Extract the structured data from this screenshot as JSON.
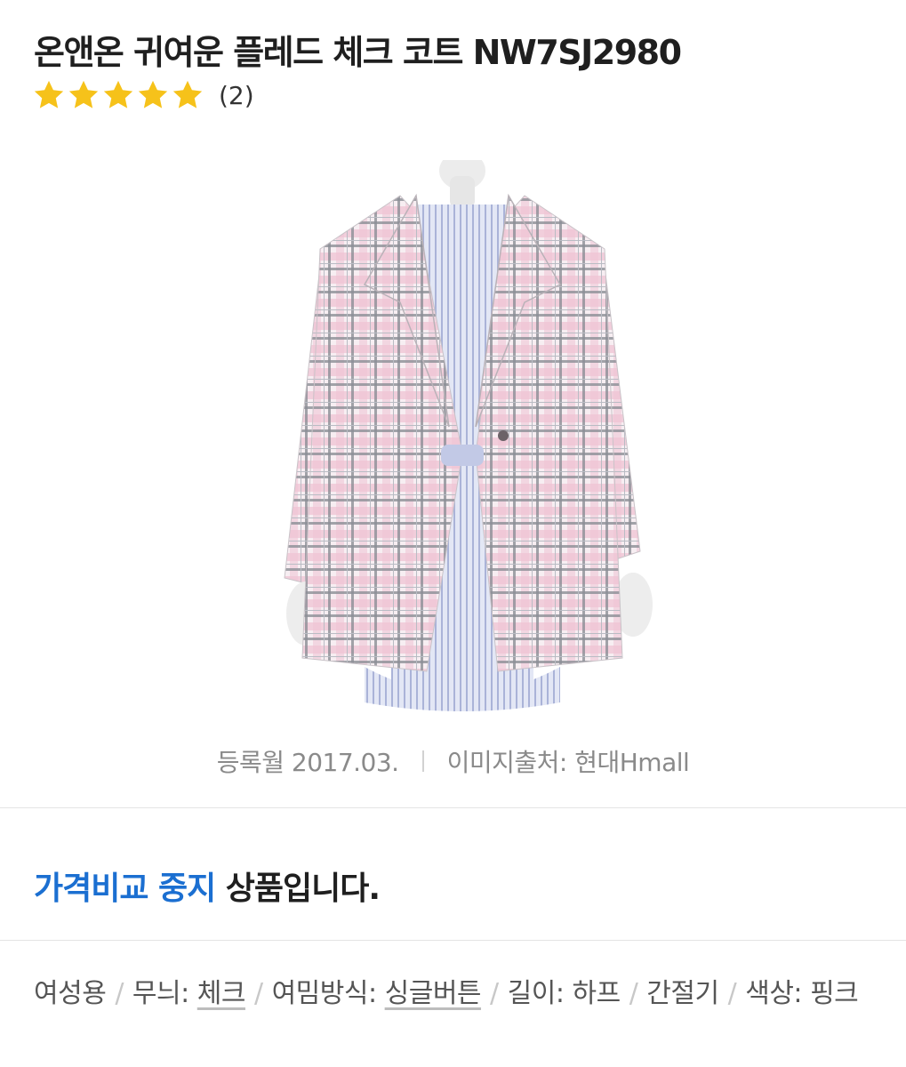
{
  "product": {
    "title": "온앤온 귀여운 플레드 체크 코트 NW7SJ2980",
    "rating": {
      "stars": 5,
      "max": 5,
      "review_count": "(2)",
      "star_color": "#f6c21a"
    },
    "image_alt": "온앤온 귀여운 플레드 체크 코트"
  },
  "meta": {
    "registered": "등록월 2017.03.",
    "image_source": "이미지출처: 현대Hmall"
  },
  "status": {
    "accent_text": "가격비교 중지",
    "rest_text": " 상품입니다.",
    "accent_color": "#1b6fd1"
  },
  "specs": {
    "gender": "여성용",
    "pattern_label": "무늬: ",
    "pattern_value": "체크",
    "closure_label": "여밈방식: ",
    "closure_value": "싱글버튼",
    "length_label": "길이: ",
    "length_value": "하프",
    "season": "간절기",
    "color_label": "색상: ",
    "color_value": "핑크"
  }
}
